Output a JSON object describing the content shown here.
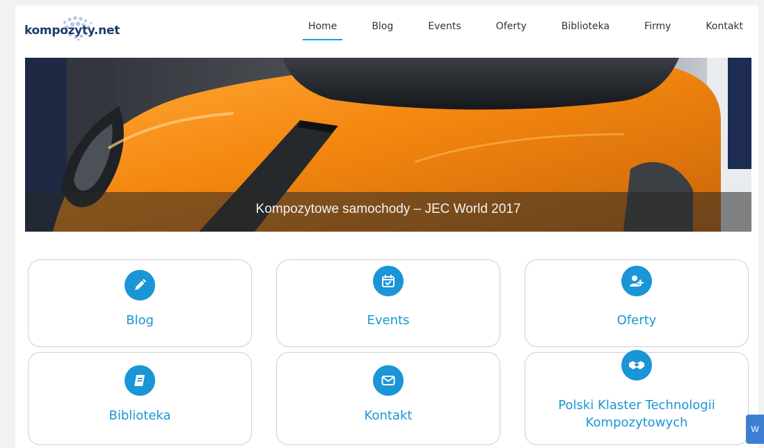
{
  "header": {
    "logo_text": "kompozyty.net",
    "nav": [
      {
        "label": "Home",
        "active": true
      },
      {
        "label": "Blog"
      },
      {
        "label": "Events"
      },
      {
        "label": "Oferty"
      },
      {
        "label": "Biblioteka"
      },
      {
        "label": "Firmy"
      },
      {
        "label": "Kontakt"
      }
    ]
  },
  "hero": {
    "caption": "Kompozytowe samochody – JEC World 2017"
  },
  "cards": [
    {
      "label": "Blog",
      "icon": "pencil-icon"
    },
    {
      "label": "Events",
      "icon": "calendar-check-icon"
    },
    {
      "label": "Oferty",
      "icon": "user-plus-icon"
    },
    {
      "label": "Biblioteka",
      "icon": "book-icon"
    },
    {
      "label": "Kontakt",
      "icon": "envelope-icon"
    },
    {
      "label": "Polski Klaster Technologii Kompozytowych",
      "icon": "handshake-icon"
    }
  ],
  "chat_tab": {
    "label": "W"
  },
  "colors": {
    "accent": "#1a95d6",
    "nav_underline": "#1aa0dc",
    "logo": "#1b3c6e",
    "car": "#f28a13"
  }
}
